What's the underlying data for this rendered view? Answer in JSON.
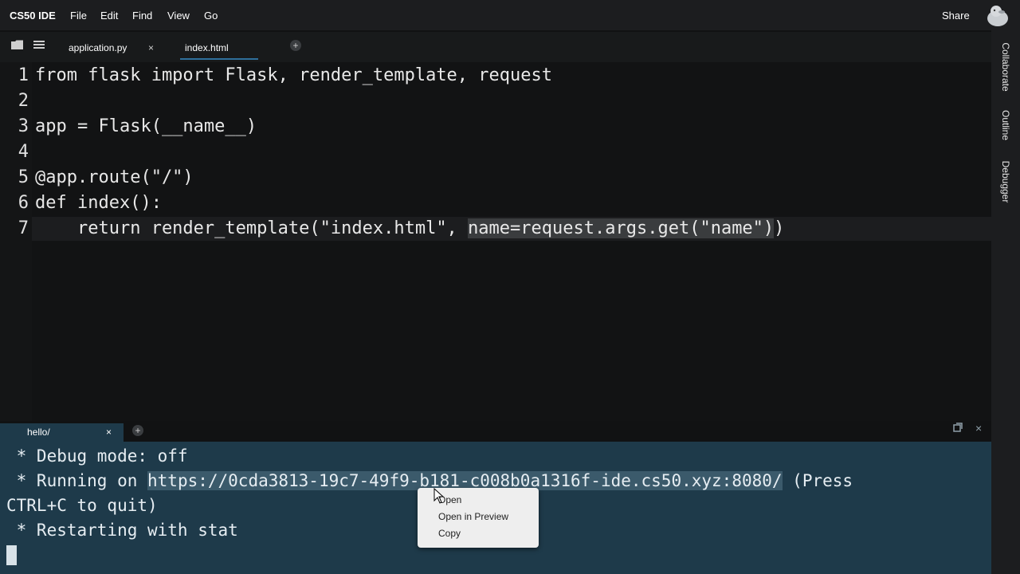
{
  "menubar": {
    "brand": "CS50 IDE",
    "items": [
      "File",
      "Edit",
      "Find",
      "View",
      "Go"
    ],
    "share": "Share"
  },
  "tabs": [
    {
      "label": "application.py",
      "close": "×"
    },
    {
      "label": "index.html",
      "close": ""
    }
  ],
  "editor": {
    "lines": [
      {
        "no": "1",
        "code": "from flask import Flask, render_template, request"
      },
      {
        "no": "2",
        "code": ""
      },
      {
        "no": "3",
        "code": "app = Flask(__name__)"
      },
      {
        "no": "4",
        "code": ""
      },
      {
        "no": "5",
        "code": "@app.route(\"/\")"
      },
      {
        "no": "6",
        "code": "def index():"
      },
      {
        "no": "7",
        "code_prefix": "    return render_template(\"index.html\", ",
        "code_selected": "name=request.args.get(\"name\")",
        "code_suffix": ")"
      }
    ]
  },
  "sidebar": {
    "items": [
      "Collaborate",
      "Outline",
      "Debugger"
    ]
  },
  "terminal": {
    "tab": {
      "label": "hello/",
      "close": "×"
    },
    "lines": [
      {
        "text": " * Debug mode: off"
      },
      {
        "prefix": " * Running on ",
        "link": "https://0cda3813-19c7-49f9-b181-c008b0a1316f-ide.cs50.xyz:8080/",
        "suffix": " (Press"
      },
      {
        "text": "CTRL+C to quit)"
      },
      {
        "text": " * Restarting with stat"
      }
    ]
  },
  "context_menu": {
    "items": [
      "Open",
      "Open in Preview",
      "Copy"
    ]
  },
  "icons": [
    "folder-icon",
    "list-icon",
    "close-icon",
    "plus-icon",
    "maximize-icon",
    "avatar-duck-icon",
    "pointer-cursor-icon"
  ],
  "colors": {
    "terminal_bg": "#1e3a4a",
    "editor_bg": "#121314",
    "accent": "#2f6f9b"
  }
}
